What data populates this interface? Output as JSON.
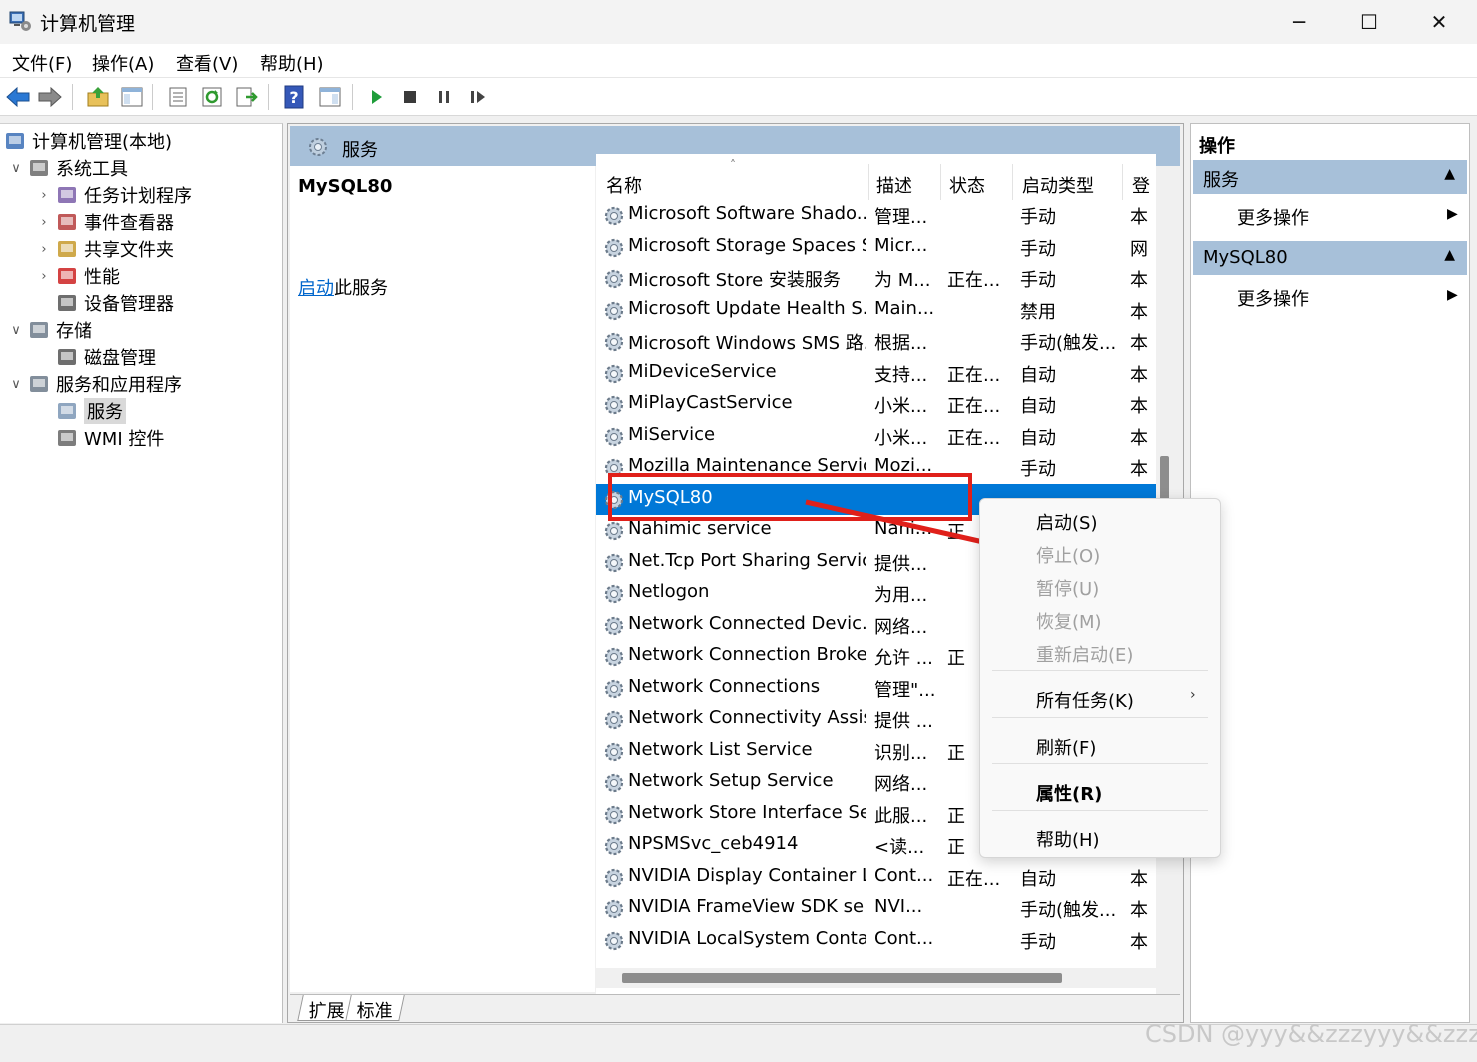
{
  "window": {
    "title": "计算机管理",
    "controls": {
      "minimize": "─",
      "maximize": "☐",
      "close": "✕"
    }
  },
  "menubar": [
    "文件(F)",
    "操作(A)",
    "查看(V)",
    "帮助(H)"
  ],
  "toolbar": {
    "icons": [
      "back-arrow-icon",
      "forward-arrow-icon",
      "up-folder-icon",
      "show-hide-tree-icon",
      "properties-icon",
      "refresh-icon",
      "export-list-icon",
      "help-icon",
      "show-hide-action-pane-icon",
      "start-service-icon",
      "stop-service-icon",
      "pause-service-icon",
      "restart-service-icon"
    ]
  },
  "tree": {
    "items": [
      {
        "label": "计算机管理(本地)",
        "icon": "computer-management-icon",
        "expander": ""
      },
      {
        "label": "系统工具",
        "icon": "system-tools-icon",
        "expander": "∨"
      },
      {
        "label": "任务计划程序",
        "icon": "task-scheduler-icon",
        "expander": "›"
      },
      {
        "label": "事件查看器",
        "icon": "event-viewer-icon",
        "expander": "›"
      },
      {
        "label": "共享文件夹",
        "icon": "shared-folders-icon",
        "expander": "›"
      },
      {
        "label": "性能",
        "icon": "performance-icon",
        "expander": "›"
      },
      {
        "label": "设备管理器",
        "icon": "device-manager-icon",
        "expander": ""
      },
      {
        "label": "存储",
        "icon": "storage-icon",
        "expander": "∨"
      },
      {
        "label": "磁盘管理",
        "icon": "disk-management-icon",
        "expander": ""
      },
      {
        "label": "服务和应用程序",
        "icon": "services-applications-icon",
        "expander": "∨"
      },
      {
        "label": "服务",
        "icon": "services-gear-icon",
        "expander": ""
      },
      {
        "label": "WMI 控件",
        "icon": "wmi-control-icon",
        "expander": ""
      }
    ]
  },
  "center": {
    "header_title": "服务",
    "selected_service": "MySQL80",
    "action_link": "启动",
    "action_suffix": "此服务",
    "columns": [
      "名称",
      "描述",
      "状态",
      "启动类型",
      "登"
    ],
    "sort_indicator": "˄",
    "rows": [
      {
        "name": "Microsoft Software Shado...",
        "desc": "管理...",
        "status": "",
        "start": "手动",
        "logon": "本"
      },
      {
        "name": "Microsoft Storage Spaces S...",
        "desc": "Micr...",
        "status": "",
        "start": "手动",
        "logon": "网"
      },
      {
        "name": "Microsoft Store 安装服务",
        "desc": "为 M...",
        "status": "正在...",
        "start": "手动",
        "logon": "本"
      },
      {
        "name": "Microsoft Update Health S...",
        "desc": "Main...",
        "status": "",
        "start": "禁用",
        "logon": "本"
      },
      {
        "name": "Microsoft Windows SMS 路...",
        "desc": "根据...",
        "status": "",
        "start": "手动(触发...",
        "logon": "本"
      },
      {
        "name": "MiDeviceService",
        "desc": "支持...",
        "status": "正在...",
        "start": "自动",
        "logon": "本"
      },
      {
        "name": "MiPlayCastService",
        "desc": "小米...",
        "status": "正在...",
        "start": "自动",
        "logon": "本"
      },
      {
        "name": "MiService",
        "desc": "小米...",
        "status": "正在...",
        "start": "自动",
        "logon": "本"
      },
      {
        "name": "Mozilla Maintenance Service",
        "desc": "Mozi...",
        "status": "",
        "start": "手动",
        "logon": "本"
      },
      {
        "name": "MySQL80",
        "desc": "",
        "status": "",
        "start": "",
        "logon": ""
      },
      {
        "name": "Nahimic service",
        "desc": "Nahi...",
        "status": "正",
        "start": "",
        "logon": ""
      },
      {
        "name": "Net.Tcp Port Sharing Service",
        "desc": "提供...",
        "status": "",
        "start": "",
        "logon": ""
      },
      {
        "name": "Netlogon",
        "desc": "为用...",
        "status": "",
        "start": "",
        "logon": ""
      },
      {
        "name": "Network Connected Devic...",
        "desc": "网络...",
        "status": "",
        "start": "",
        "logon": ""
      },
      {
        "name": "Network Connection Broker",
        "desc": "允许 ...",
        "status": "正",
        "start": "",
        "logon": ""
      },
      {
        "name": "Network Connections",
        "desc": "管理\"...",
        "status": "",
        "start": "",
        "logon": ""
      },
      {
        "name": "Network Connectivity Assis...",
        "desc": "提供 ...",
        "status": "",
        "start": "",
        "logon": ""
      },
      {
        "name": "Network List Service",
        "desc": "识别...",
        "status": "正",
        "start": "",
        "logon": ""
      },
      {
        "name": "Network Setup Service",
        "desc": "网络...",
        "status": "",
        "start": "",
        "logon": ""
      },
      {
        "name": "Network Store Interface Se...",
        "desc": "此服...",
        "status": "正",
        "start": "",
        "logon": ""
      },
      {
        "name": "NPSMSvc_ceb4914",
        "desc": "<读...",
        "status": "正",
        "start": "",
        "logon": ""
      },
      {
        "name": "NVIDIA Display Container LS",
        "desc": "Cont...",
        "status": "正在...",
        "start": "自动",
        "logon": "本"
      },
      {
        "name": "NVIDIA FrameView SDK se...",
        "desc": "NVI...",
        "status": "",
        "start": "手动(触发...",
        "logon": "本"
      },
      {
        "name": "NVIDIA LocalSystem Conta...",
        "desc": "Cont...",
        "status": "",
        "start": "手动",
        "logon": "本"
      }
    ],
    "selected_row_index": 9,
    "tabs": [
      "扩展",
      "标准"
    ]
  },
  "actions": {
    "title": "操作",
    "sections": [
      {
        "label": "服务",
        "item": "更多操作"
      },
      {
        "label": "MySQL80",
        "item": "更多操作"
      }
    ]
  },
  "context_menu": {
    "items": [
      {
        "label": "启动(S)",
        "disabled": false,
        "bold": false
      },
      {
        "label": "停止(O)",
        "disabled": true,
        "bold": false
      },
      {
        "label": "暂停(U)",
        "disabled": true,
        "bold": false
      },
      {
        "label": "恢复(M)",
        "disabled": true,
        "bold": false
      },
      {
        "label": "重新启动(E)",
        "disabled": true,
        "bold": false
      },
      {
        "label": "所有任务(K)",
        "disabled": false,
        "bold": false,
        "submenu": true
      },
      {
        "label": "刷新(F)",
        "disabled": false,
        "bold": false
      },
      {
        "label": "属性(R)",
        "disabled": false,
        "bold": true
      },
      {
        "label": "帮助(H)",
        "disabled": false,
        "bold": false
      }
    ],
    "submenu_arrow": "›"
  },
  "watermark": "CSDN @yyy&&zzzyyy&&zzz",
  "colors": {
    "selection": "#0078d7",
    "header_band": "#a7c0d9",
    "annotation_red": "#e0201a",
    "link": "#0066cc"
  }
}
